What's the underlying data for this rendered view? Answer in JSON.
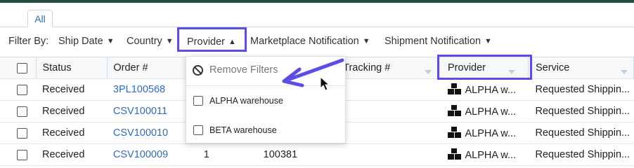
{
  "tabs": [
    {
      "label": "All"
    }
  ],
  "filter_bar": {
    "label": "Filter By:",
    "filters": [
      {
        "label": "Ship Date"
      },
      {
        "label": "Country"
      },
      {
        "label": "Provider"
      },
      {
        "label": "Marketplace Notification"
      },
      {
        "label": "Shipment Notification"
      }
    ]
  },
  "table": {
    "columns": [
      "Status",
      "Order #",
      "",
      "Tracking #",
      "Provider",
      "Service"
    ],
    "rows": [
      {
        "status": "Received",
        "order": "3PL100568",
        "qty": "",
        "ref": "",
        "provider": "ALPHA w...",
        "service": "Requested Shippin..."
      },
      {
        "status": "Received",
        "order": "CSV100011",
        "qty": "",
        "ref": "",
        "provider": "ALPHA w...",
        "service": "Requested Shippin..."
      },
      {
        "status": "Received",
        "order": "CSV100010",
        "qty": "",
        "ref": "",
        "provider": "ALPHA w...",
        "service": "Requested Shippin..."
      },
      {
        "status": "Received",
        "order": "CSV100009",
        "qty": "1",
        "ref": "100381",
        "provider": "ALPHA w...",
        "service": "Requested Shippin..."
      }
    ]
  },
  "provider_dropdown": {
    "remove_filters": "Remove Filters",
    "options": [
      {
        "label": "ALPHA warehouse"
      },
      {
        "label": "BETA warehouse"
      }
    ]
  },
  "icons": {
    "provider": "warehouse-boxes-icon",
    "remove_filters": "ban-icon",
    "caret_down": "caret-down-icon",
    "caret_up": "caret-up-icon"
  },
  "colors": {
    "accent_highlight": "#5b4ee6",
    "link": "#2e6bc6",
    "topbar": "#1f4d3a"
  }
}
